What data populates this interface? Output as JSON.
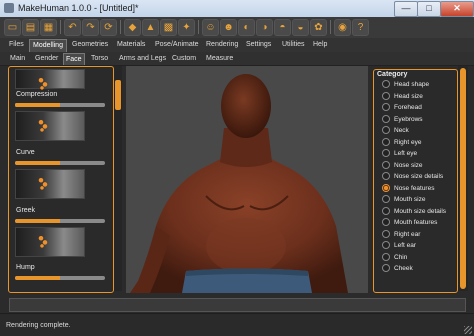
{
  "window": {
    "title": "MakeHuman 1.0.0 - [Untitled]*",
    "min_label": "—",
    "max_label": "□",
    "close_label": "✕"
  },
  "toolbar": {
    "icons": [
      "new-file-icon",
      "save-icon",
      "load-icon",
      "undo-icon",
      "redo-icon",
      "reset-icon",
      "smooth-icon",
      "wireframe-icon",
      "background-icon",
      "pose-icon",
      "front-view-icon",
      "back-view-icon",
      "left-view-icon",
      "right-view-icon",
      "top-view-icon",
      "bottom-view-icon",
      "reset-camera-icon",
      "screenshot-icon",
      "help-icon"
    ]
  },
  "menu": {
    "tabs": [
      "Files",
      "Modelling",
      "Geometries",
      "Materials",
      "Pose/Animate",
      "Rendering",
      "Settings",
      "Utilities",
      "Help"
    ],
    "active": "Modelling"
  },
  "subtabs": {
    "tabs": [
      "Main",
      "Gender",
      "Face",
      "Torso",
      "Arms and Legs",
      "Custom",
      "Measure"
    ],
    "active": "Face"
  },
  "left_panel": {
    "modifiers": [
      {
        "label": "Compression",
        "value": 0.5
      },
      {
        "label": "Curve",
        "value": 0.5
      },
      {
        "label": "Greek",
        "value": 0.5
      },
      {
        "label": "Hump",
        "value": 0.5
      }
    ]
  },
  "category": {
    "title": "Category",
    "items": [
      "Head shape",
      "Head size",
      "Forehead",
      "Eyebrows",
      "Neck",
      "Right eye",
      "Left eye",
      "Nose size",
      "Nose size details",
      "Nose features",
      "Mouth size",
      "Mouth size details",
      "Mouth features",
      "Right ear",
      "Left ear",
      "Chin",
      "Cheek"
    ],
    "selected": "Nose features"
  },
  "status": {
    "text": "Rendering complete."
  },
  "colors": {
    "accent": "#e8962c",
    "background": "#2b2b2b",
    "viewport": "#494949",
    "skin": "#6b2f1c"
  }
}
